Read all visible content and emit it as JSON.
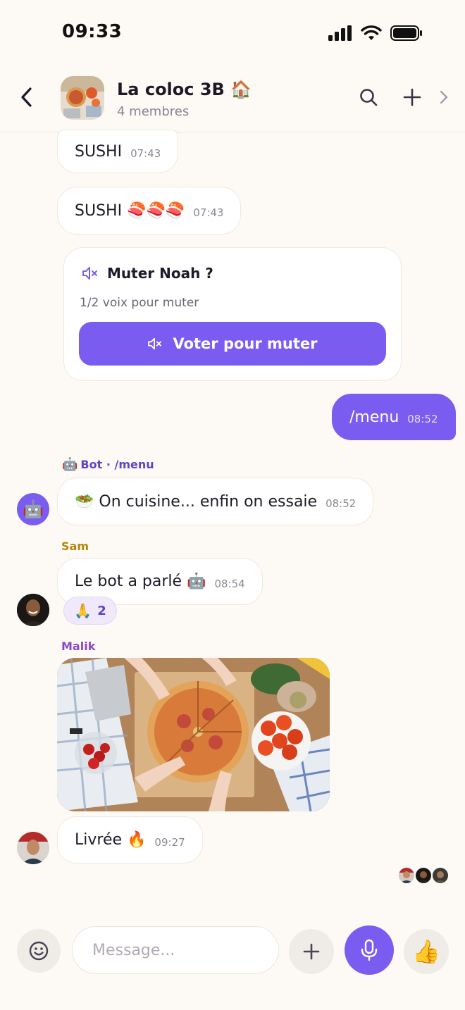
{
  "status_bar": {
    "time": "09:33"
  },
  "header": {
    "title": "La coloc 3B 🏠",
    "subtitle": "4 membres"
  },
  "messages": {
    "m1": {
      "text": "SUSHI",
      "time": "07:43"
    },
    "m2": {
      "text": "SUSHI 🍣🍣🍣",
      "time": "07:43"
    },
    "poll": {
      "title": "Muter Noah ?",
      "votes": "1/2 voix pour muter",
      "button": "Voter pour muter"
    },
    "m3": {
      "text": "/menu",
      "time": "08:52"
    },
    "bot": {
      "sender_emoji": "🤖",
      "sender": "Bot",
      "sender_sep": " · ",
      "command": "/menu",
      "text": "🥗 On cuisine... enfin on essaie",
      "time": "08:52",
      "avatar_emoji": "🤖"
    },
    "sam": {
      "sender": "Sam",
      "text": "Le bot a parlé 🤖",
      "time": "08:54",
      "reaction_emoji": "🙏",
      "reaction_count": "2"
    },
    "malik": {
      "sender": "Malik",
      "text": "Livrée 🔥",
      "time": "09:27"
    }
  },
  "composer": {
    "placeholder": "Message...",
    "like_emoji": "👍"
  },
  "colors": {
    "accent": "#7b5cf0",
    "background": "#fdf9f4",
    "bot_name": "#5d44c9",
    "sam_name": "#b8860b",
    "malik_name": "#8a46c9"
  },
  "icons": [
    "back-icon",
    "search-icon",
    "plus-icon",
    "chevron-right-icon",
    "mute-icon",
    "emoji-icon",
    "mic-icon"
  ]
}
